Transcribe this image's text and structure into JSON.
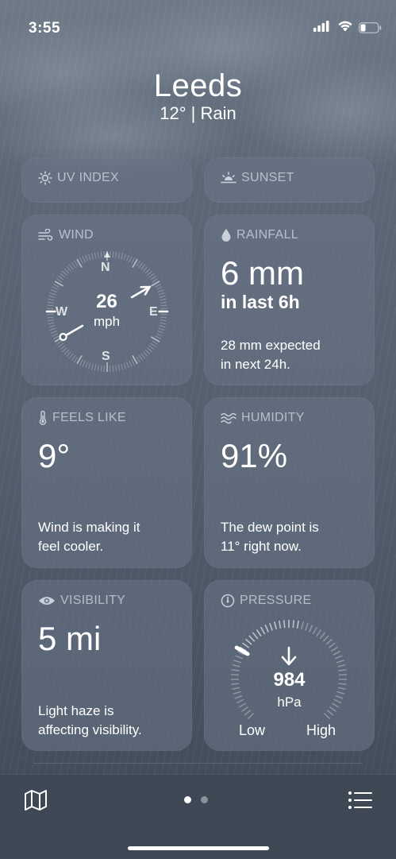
{
  "status_bar": {
    "time": "3:55"
  },
  "header": {
    "city": "Leeds",
    "condition": "12°  |  Rain"
  },
  "uv_index": {
    "label": "UV INDEX"
  },
  "sunset": {
    "label": "SUNSET"
  },
  "wind": {
    "label": "WIND",
    "speed": "26",
    "unit": "mph",
    "compass": {
      "n": "N",
      "e": "E",
      "s": "S",
      "w": "W"
    },
    "direction_deg": 240
  },
  "rainfall": {
    "label": "RAINFALL",
    "amount": "6 mm",
    "period": "in last 6h",
    "forecast_line1": "28 mm expected",
    "forecast_line2": "in next 24h."
  },
  "feels_like": {
    "label": "FEELS LIKE",
    "value": "9°",
    "desc_line1": "Wind is making it",
    "desc_line2": "feel cooler."
  },
  "humidity": {
    "label": "HUMIDITY",
    "value": "91%",
    "desc_line1": "The dew point is",
    "desc_line2": "11° right now."
  },
  "visibility": {
    "label": "VISIBILITY",
    "value": "5 mi",
    "desc_line1": "Light haze is",
    "desc_line2": "affecting visibility."
  },
  "pressure": {
    "label": "PRESSURE",
    "value": "984",
    "unit": "hPa",
    "low_label": "Low",
    "high_label": "High",
    "trend": "falling"
  },
  "tab_bar": {
    "page_count": 2,
    "active_page": 1,
    "icons": [
      "map-icon",
      "list-icon"
    ]
  },
  "colors": {
    "text": "#ffffff",
    "label": "#c9d0da",
    "card": "#6a778a"
  }
}
